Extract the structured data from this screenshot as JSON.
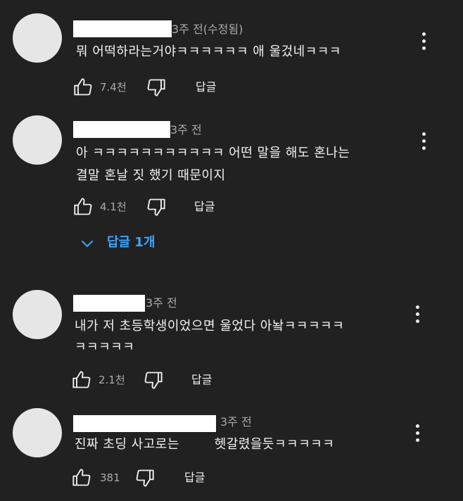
{
  "comments": [
    {
      "time": "3주 전(수정됨)",
      "lines": [
        "뭐 어떡하라는거야ㅋㅋㅋㅋㅋㅋ 애 울겄네ㅋㅋㅋ"
      ],
      "likes": "7.4천",
      "reply_label": "답글"
    },
    {
      "time": "3주 전",
      "lines": [
        "아 ㅋㅋㅋㅋㅋㅋㅋㅋㅋㅋㅋ 어떤 말을 해도 혼나는",
        "결말 혼날 짓 했기 때문이지"
      ],
      "likes": "4.1천",
      "reply_label": "답글",
      "replies_toggle": "답글 1개"
    },
    {
      "time": "3주 전",
      "lines": [
        "내가 저 초등학생이었으면 울었다 아놬ㅋㅋㅋㅋㅋ",
        "ㅋㅋㅋㅋㅋ"
      ],
      "likes": "2.1천",
      "reply_label": "답글"
    },
    {
      "time": "3주 전",
      "lines": [
        "진짜 초딩 사고로는        헷갈렸을듯ㅋㅋㅋㅋㅋ"
      ],
      "likes": "381",
      "reply_label": "답글"
    }
  ],
  "icons": {
    "like": "thumb-up-icon",
    "dislike": "thumb-down-icon",
    "menu": "more-vert-icon",
    "expand": "chevron-down-icon"
  },
  "colors": {
    "background": "#212121",
    "text": "#f1f1f1",
    "secondary": "#aaaaaa",
    "link": "#3ea6ff",
    "avatar": "#e6e6e6"
  }
}
